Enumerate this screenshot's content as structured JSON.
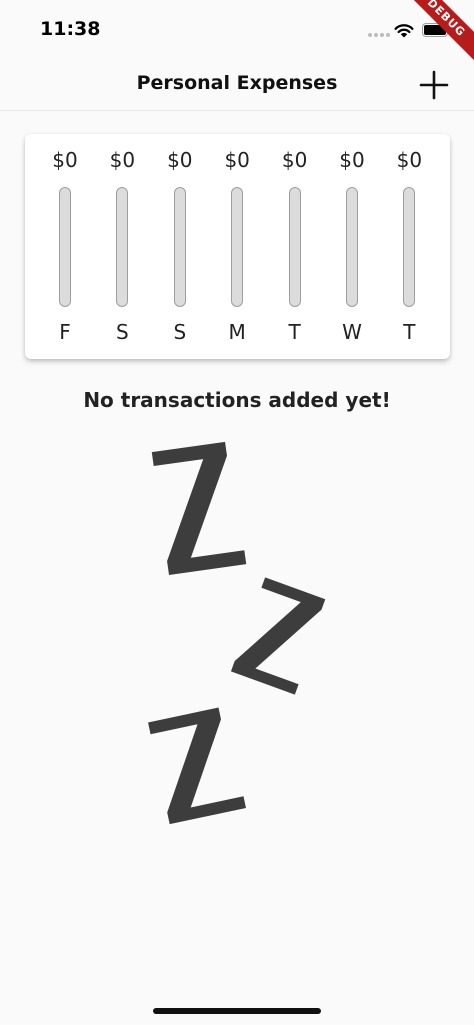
{
  "status_bar": {
    "time": "11:38"
  },
  "debug_banner": "DEBUG",
  "app_bar": {
    "title": "Personal Expenses",
    "add_icon": "plus-icon"
  },
  "chart_data": {
    "type": "bar",
    "categories": [
      "F",
      "S",
      "S",
      "M",
      "T",
      "W",
      "T"
    ],
    "values": [
      0,
      0,
      0,
      0,
      0,
      0,
      0
    ],
    "amount_labels": [
      "$0",
      "$0",
      "$0",
      "$0",
      "$0",
      "$0",
      "$0"
    ]
  },
  "empty_state": {
    "message": "No transactions added yet!",
    "image": "sleeping-zzz"
  },
  "colors": {
    "bar_track": "#dcdcdc",
    "bar_border": "#9e9e9e",
    "text": "#222222",
    "banner": "#b71c1c"
  }
}
